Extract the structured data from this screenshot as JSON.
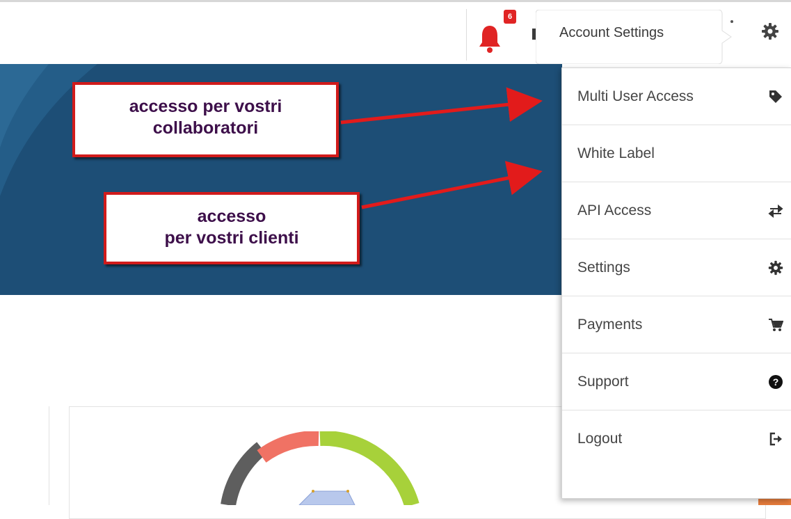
{
  "topbar": {
    "notification_count": "6",
    "tooltip_label": "Account Settings"
  },
  "callouts": [
    {
      "line1": "accesso per vostri",
      "line2": "collaboratori"
    },
    {
      "line1": "accesso",
      "line2": "per vostri clienti"
    }
  ],
  "menu": {
    "items": [
      {
        "label": "Multi User Access",
        "icon": "tag-icon"
      },
      {
        "label": "White Label",
        "icon": ""
      },
      {
        "label": "API Access",
        "icon": "exchange-icon"
      },
      {
        "label": "Settings",
        "icon": "gear-icon"
      },
      {
        "label": "Payments",
        "icon": "cart-icon"
      },
      {
        "label": "Support",
        "icon": "question-circle-icon"
      },
      {
        "label": "Logout",
        "icon": "sign-out-icon"
      }
    ]
  },
  "colors": {
    "hero_background": "#1d4e76",
    "annotation_red": "#d11b1b",
    "callout_text": "#3d0f4a",
    "gauge_green": "#a7d13a",
    "gauge_red": "#f07264",
    "gauge_gray": "#5e5e5e"
  }
}
